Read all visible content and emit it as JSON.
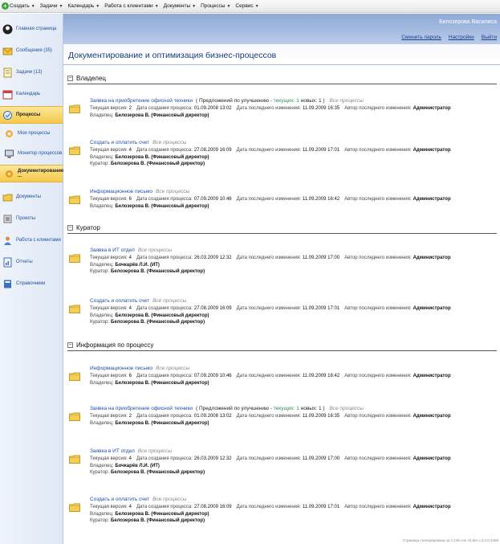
{
  "menubar": {
    "items": [
      {
        "label": "Создать",
        "icon": "plus-icon"
      },
      {
        "label": "Задачи"
      },
      {
        "label": "Календарь"
      },
      {
        "label": "Работа с клиентами"
      },
      {
        "label": "Документы"
      },
      {
        "label": "Процессы"
      },
      {
        "label": "Сервис"
      }
    ]
  },
  "sidebar": {
    "items": [
      {
        "label": "Главная страница",
        "icon": "home-icon"
      },
      {
        "label": "Сообщения (35)",
        "icon": "mail-icon"
      },
      {
        "label": "Задачи (13)",
        "icon": "tasks-icon"
      },
      {
        "label": "Календарь",
        "icon": "calendar-icon"
      },
      {
        "label": "Процессы",
        "icon": "processes-icon"
      },
      {
        "label": "Мои процессы",
        "icon": "my-processes-icon"
      },
      {
        "label": "Монитор процессов",
        "icon": "monitor-icon"
      },
      {
        "label": "Документирование ...",
        "icon": "documenting-icon"
      },
      {
        "label": "Документы",
        "icon": "documents-icon"
      },
      {
        "label": "Проекты",
        "icon": "projects-icon"
      },
      {
        "label": "Работа с клиентами",
        "icon": "clients-icon"
      },
      {
        "label": "Отчеты",
        "icon": "reports-icon"
      },
      {
        "label": "Справочники",
        "icon": "reference-icon"
      }
    ]
  },
  "header": {
    "username": "Белозерова Василиса",
    "links": [
      "Сменить пароль",
      "Настройки",
      "Выйти"
    ]
  },
  "page_title": "Документирование и оптимизация бизнес-процессов",
  "labels": {
    "version": "Текущая версия:",
    "created": "Дата создания процесса:",
    "modified": "Дата последнего изменения:",
    "author": "Автор последнего изменения:",
    "owner": "Владелец:",
    "curator": "Куратор:",
    "all_processes": "Все процессы",
    "improve_prefix": "( Предложений по улучшению -",
    "improve_current": "текущих: 1",
    "improve_new": "новых: 1 )"
  },
  "sections": [
    {
      "title": "Владелец",
      "entries": [
        {
          "name": "Заявка на приобретение офисной техники",
          "improve": true,
          "version": "2",
          "created": "01.09.2008 13:02",
          "modified": "11.09.2009 16:35",
          "author": "Администратор",
          "owner": "Белозерова В. (Финансовый директор)"
        },
        {
          "name": "Создать и оплатить счет",
          "version": "4",
          "created": "27.08.2009 16:09",
          "modified": "11.09.2009 17:01",
          "author": "Администратор",
          "owner": "Белозерова В. (Финансовый директор)",
          "curator": "Белозерова В. (Финансовый директор)"
        },
        {
          "name": "Информационное письмо",
          "version": "6",
          "created": "07.09.2009 10:46",
          "modified": "11.09.2009 16:42",
          "author": "Администратор",
          "owner": "Белозерова В. (Финансовый директор)"
        }
      ]
    },
    {
      "title": "Куратор",
      "entries": [
        {
          "name": "Заявка в ИТ отдел",
          "version": "4",
          "created": "26.03.2009 12:32",
          "modified": "11.09.2009 17:00",
          "author": "Администратор",
          "owner": "Бочкарёв Л.И. (ИТ)",
          "curator": "Белозерова В. (Финансовый директор)"
        },
        {
          "name": "Создать и оплатить счет",
          "version": "4",
          "created": "27.08.2009 16:09",
          "modified": "11.09.2009 17:01",
          "author": "Администратор",
          "owner": "Белозерова В. (Финансовый директор)",
          "curator": "Белозерова В. (Финансовый директор)"
        }
      ]
    },
    {
      "title": "Информация по процессу",
      "entries": [
        {
          "name": "Информационное письмо",
          "version": "6",
          "created": "07.09.2009 10:46",
          "modified": "11.09.2009 16:42",
          "author": "Администратор",
          "owner": "Белозерова В. (Финансовый директор)"
        },
        {
          "name": "Заявка на приобретение офисной техники",
          "improve": true,
          "version": "2",
          "created": "01.09.2008 13:02",
          "modified": "11.09.2009 16:35",
          "author": "Администратор",
          "owner": "Белозерова В. (Финансовый директор)"
        },
        {
          "name": "Заявка в ИТ отдел",
          "version": "4",
          "created": "26.03.2009 12:32",
          "modified": "11.09.2009 17:00",
          "author": "Администратор",
          "owner": "Бочкарёв Л.И. (ИТ)",
          "curator": "Белозерова В. (Финансовый директор)"
        },
        {
          "name": "Создать и оплатить счет",
          "version": "4",
          "created": "27.08.2009 16:09",
          "modified": "11.09.2009 17:01",
          "author": "Администратор",
          "owner": "Белозерова В. (Финансовый директор)",
          "curator": "Белозерова В. (Финансовый директор)"
        }
      ]
    }
  ],
  "footer": "Страница сгенерирована за 1,145 сек. ELMA v.2.2.0.4469"
}
